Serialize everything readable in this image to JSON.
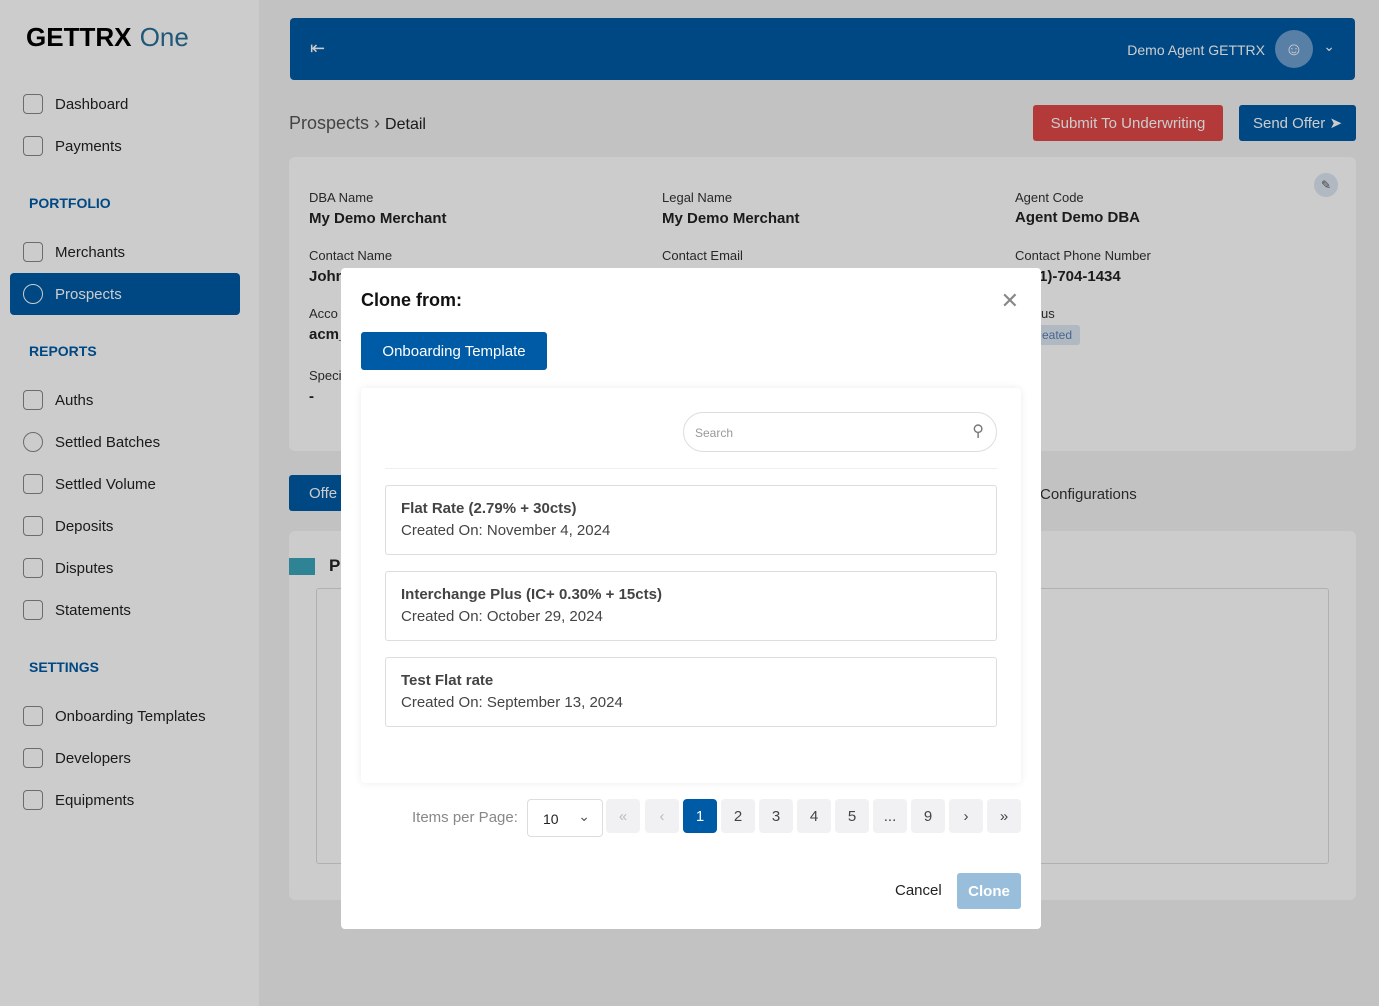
{
  "logo": {
    "brand": "GETTRX",
    "suffix": "One"
  },
  "sidebar": {
    "items": [
      {
        "label": "Dashboard",
        "icon": "home-icon"
      },
      {
        "label": "Payments",
        "icon": "card-icon"
      }
    ],
    "sections": [
      {
        "title": "PORTFOLIO",
        "items": [
          {
            "label": "Merchants",
            "icon": "merchant-icon"
          },
          {
            "label": "Prospects",
            "icon": "prospect-search-icon",
            "active": true
          }
        ]
      },
      {
        "title": "REPORTS",
        "items": [
          {
            "label": "Auths",
            "icon": "shield-icon"
          },
          {
            "label": "Settled Batches",
            "icon": "info-icon"
          },
          {
            "label": "Settled Volume",
            "icon": "bar-chart-icon"
          },
          {
            "label": "Deposits",
            "icon": "bank-icon"
          },
          {
            "label": "Disputes",
            "icon": "warning-icon"
          },
          {
            "label": "Statements",
            "icon": "document-icon"
          }
        ]
      },
      {
        "title": "SETTINGS",
        "items": [
          {
            "label": "Onboarding Templates",
            "icon": "dollar-doc-icon"
          },
          {
            "label": "Developers",
            "icon": "code-icon"
          },
          {
            "label": "Equipments",
            "icon": "calculator-icon"
          }
        ]
      }
    ]
  },
  "header": {
    "user": "Demo Agent GETTRX"
  },
  "breadcrumb": {
    "parent": "Prospects",
    "current": "Detail"
  },
  "actions": {
    "submit": "Submit To Underwriting",
    "send": "Send Offer"
  },
  "colors": {
    "primary": "#005ba6",
    "danger": "#e24848"
  },
  "details": {
    "dba_label": "DBA Name",
    "dba": "My Demo Merchant",
    "legal_label": "Legal Name",
    "legal": "My Demo Merchant",
    "agent_label": "Agent Code",
    "agent": "Agent Demo DBA",
    "contact_label": "Contact Name",
    "contact": "John",
    "email_label": "Contact Email",
    "phone_label": "Contact Phone Number",
    "phone": "1)-704-1434",
    "account_label": "Acco",
    "account": "acm_",
    "status_label": "us",
    "status": "eated",
    "special_label": "Speci",
    "special": "-"
  },
  "tabs": {
    "offer": "Offe",
    "config": "Configurations"
  },
  "section_p": "P",
  "modal": {
    "title": "Clone from:",
    "tab": "Onboarding Template",
    "search_placeholder": "Search",
    "items": [
      {
        "title": "Flat Rate (2.79% + 30cts)",
        "date": "Created On: November 4, 2024"
      },
      {
        "title": "Interchange Plus (IC+ 0.30% + 15cts)",
        "date": "Created On: October 29, 2024"
      },
      {
        "title": "Test Flat rate",
        "date": "Created On: September 13, 2024"
      }
    ],
    "items_per_page_label": "Items per Page:",
    "items_per_page": "10",
    "pages": [
      "1",
      "2",
      "3",
      "4",
      "5",
      "...",
      "9"
    ],
    "current_page": "1",
    "cancel": "Cancel",
    "clone": "Clone"
  }
}
